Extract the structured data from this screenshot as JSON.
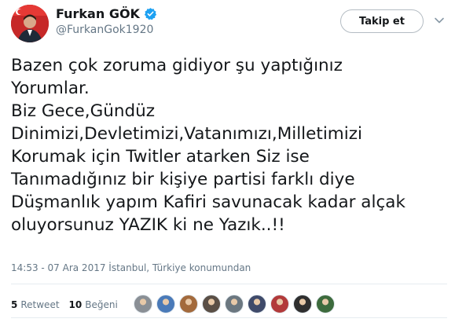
{
  "user": {
    "display_name": "Furkan GÖK",
    "handle": "@FurkanGok1920",
    "avatar_icon": "profile-photo-flag"
  },
  "follow_label": "Takip et",
  "tweet_text": "Bazen çok zoruma gidiyor şu yaptığınız\nYorumlar.\nBiz Gece,Gündüz\nDinimizi,Devletimizi,Vatanımızı,Milletimizi\nKorumak için Twitler atarken Siz ise\nTanımadığınız bir kişiye partisi farklı diye\nDüşmanlık yapım Kafiri savunacak kadar alçak\noluyorsunuz YAZIK ki ne Yazık..!!",
  "timestamp": "14:53 - 07 Ara 2017 İstanbul, Türkiye konumundan",
  "stats": {
    "retweet_count": "5",
    "retweet_label": "Retweet",
    "like_count": "10",
    "like_label": "Beğeni"
  },
  "liker_avatars": [
    {
      "color": "#8a8f95"
    },
    {
      "color": "#4a7ab8"
    },
    {
      "color": "#a36a3c"
    },
    {
      "color": "#5a4f46"
    },
    {
      "color": "#6b7780"
    },
    {
      "color": "#3f4a6a"
    },
    {
      "color": "#b23a3a"
    },
    {
      "color": "#2f2f2f"
    },
    {
      "color": "#3d6b3d"
    }
  ],
  "colors": {
    "verified_blue": "#1da1f2",
    "text": "#14171a",
    "secondary": "#657786"
  }
}
